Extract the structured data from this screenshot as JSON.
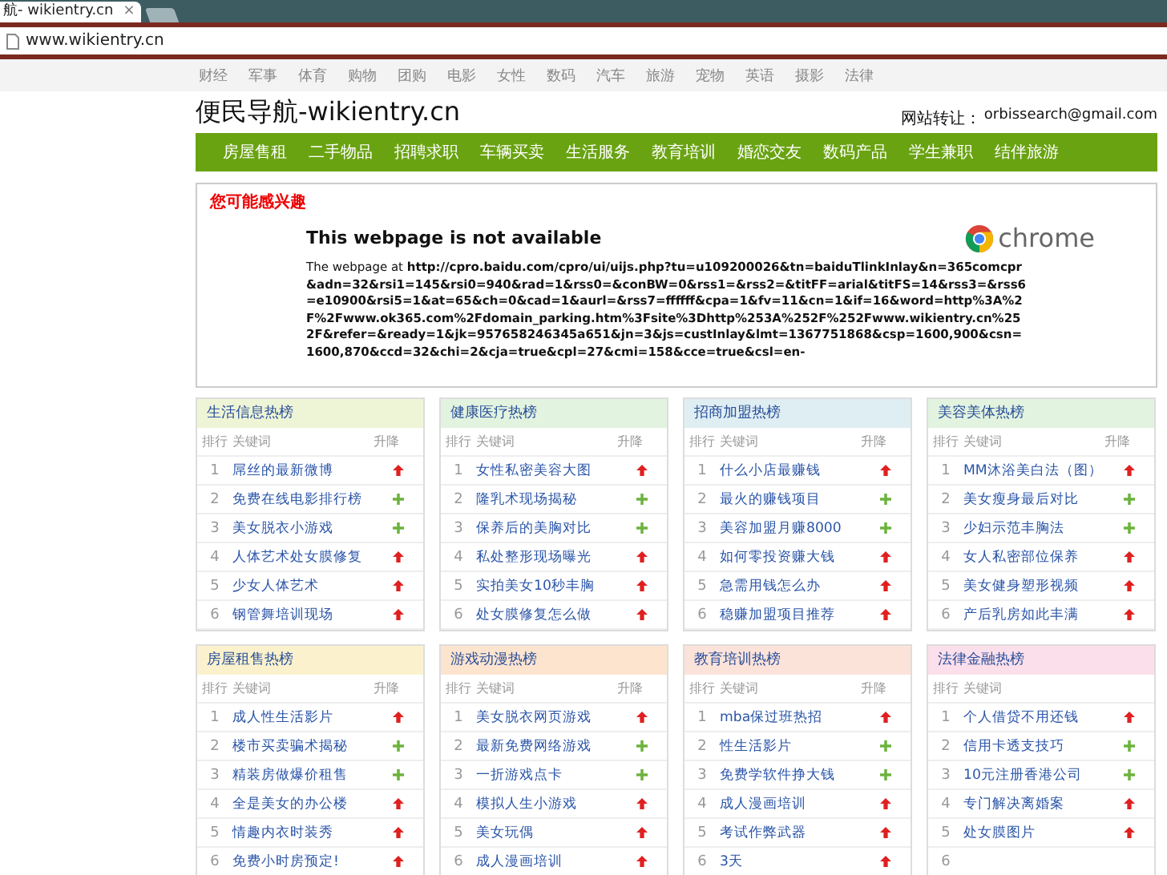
{
  "browser": {
    "tab_title": "航- wikientry.cn",
    "tab_close": "×",
    "address": "www.wikientry.cn"
  },
  "categories": [
    "财经",
    "军事",
    "体育",
    "购物",
    "团购",
    "电影",
    "女性",
    "数码",
    "汽车",
    "旅游",
    "宠物",
    "英语",
    "摄影",
    "法律"
  ],
  "site": {
    "title": "便民导航-wikientry.cn",
    "contact_label": "网站转让：",
    "contact_email": "orbissearch@gmail.com"
  },
  "nav": [
    "房屋售租",
    "二手物品",
    "招聘求职",
    "车辆买卖",
    "生活服务",
    "教育培训",
    "婚恋交友",
    "数码产品",
    "学生兼职",
    "结伴旅游"
  ],
  "notice": {
    "heading": "您可能感兴趣",
    "error_title": "This webpage is not available",
    "brand": "chrome",
    "message_prefix": "The webpage at ",
    "message_url": "http://cpro.baidu.com/cpro/ui/uijs.php?tu=u109200026&tn=baiduTlinkInlay&n=365comcpr&adn=32&rsi1=145&rsi0=940&rad=1&rss0=&conBW=0&rss1=&rss2=&titFF=arial&titFS=14&rss3=&rss6=e10900&rsi5=1&at=65&ch=0&cad=1&aurl=&rss7=ffffff&cpa=1&fv=11&cn=1&if=16&word=http%3A%2F%2Fwww.ok365.com%2Fdomain_parking.htm%3Fsite%3Dhttp%253A%252F%252Fwww.wikientry.cn%252F&refer=&ready=1&jk=957658246345a651&jn=3&js=custInlay&lmt=1367751868&csp=1600,900&csn=1600,870&ccd=32&chi=2&cja=true&cpl=27&cmi=158&cce=true&csl=en-"
  },
  "boards": [
    {
      "title": "生活信息热榜",
      "color": "#eef5d6",
      "columns": [
        "排行",
        "关键词",
        "升降"
      ],
      "rows": [
        {
          "rank": "1",
          "keyword": "屌丝的最新微博",
          "rising": true
        },
        {
          "rank": "2",
          "keyword": "免费在线电影排行榜",
          "rising": false
        },
        {
          "rank": "3",
          "keyword": "美女脱衣小游戏",
          "rising": false
        },
        {
          "rank": "4",
          "keyword": "人体艺术处女膜修复",
          "rising": true
        },
        {
          "rank": "5",
          "keyword": "少女人体艺术",
          "rising": true
        },
        {
          "rank": "6",
          "keyword": "钢管舞培训现场",
          "rising": true
        }
      ]
    },
    {
      "title": "健康医疗热榜",
      "color": "#e2f3df",
      "columns": [
        "排行",
        "关键词",
        "升降"
      ],
      "rows": [
        {
          "rank": "1",
          "keyword": "女性私密美容大图",
          "rising": true
        },
        {
          "rank": "2",
          "keyword": "隆乳术现场揭秘",
          "rising": false
        },
        {
          "rank": "3",
          "keyword": "保养后的美胸对比",
          "rising": false
        },
        {
          "rank": "4",
          "keyword": "私处整形现场曝光",
          "rising": true
        },
        {
          "rank": "5",
          "keyword": "实拍美女10秒丰胸",
          "rising": true
        },
        {
          "rank": "6",
          "keyword": "处女膜修复怎么做",
          "rising": true
        }
      ]
    },
    {
      "title": "招商加盟热榜",
      "color": "#dfeef3",
      "columns": [
        "排行",
        "关键词",
        "升降"
      ],
      "rows": [
        {
          "rank": "1",
          "keyword": "什么小店最赚钱",
          "rising": true
        },
        {
          "rank": "2",
          "keyword": "最火的赚钱项目",
          "rising": false
        },
        {
          "rank": "3",
          "keyword": "美容加盟月赚8000",
          "rising": false
        },
        {
          "rank": "4",
          "keyword": "如何零投资赚大钱",
          "rising": true
        },
        {
          "rank": "5",
          "keyword": "急需用钱怎么办",
          "rising": true
        },
        {
          "rank": "6",
          "keyword": "稳赚加盟项目推荐",
          "rising": true
        }
      ]
    },
    {
      "title": "美容美体热榜",
      "color": "#e2f3df",
      "columns": [
        "排行",
        "关键词",
        "升降"
      ],
      "rows": [
        {
          "rank": "1",
          "keyword": "MM沐浴美白法（图）",
          "rising": true
        },
        {
          "rank": "2",
          "keyword": "美女瘦身最后对比",
          "rising": false
        },
        {
          "rank": "3",
          "keyword": "少妇示范丰胸法",
          "rising": false
        },
        {
          "rank": "4",
          "keyword": "女人私密部位保养",
          "rising": true
        },
        {
          "rank": "5",
          "keyword": "美女健身塑形视频",
          "rising": true
        },
        {
          "rank": "6",
          "keyword": "产后乳房如此丰满",
          "rising": true
        }
      ]
    },
    {
      "title": "房屋租售热榜",
      "color": "#fbf2cd",
      "columns": [
        "排行",
        "关键词",
        "升降"
      ],
      "rows": [
        {
          "rank": "1",
          "keyword": "成人性生活影片",
          "rising": true
        },
        {
          "rank": "2",
          "keyword": "楼市买卖骗术揭秘",
          "rising": false
        },
        {
          "rank": "3",
          "keyword": "精装房做爆价租售",
          "rising": false
        },
        {
          "rank": "4",
          "keyword": "全是美女的办公楼",
          "rising": true
        },
        {
          "rank": "5",
          "keyword": "情趣内衣时装秀",
          "rising": true
        },
        {
          "rank": "6",
          "keyword": "免费小时房预定!",
          "rising": true
        }
      ]
    },
    {
      "title": "游戏动漫热榜",
      "color": "#fde4cf",
      "columns": [
        "排行",
        "关键词",
        "升降"
      ],
      "rows": [
        {
          "rank": "1",
          "keyword": "美女脱衣网页游戏",
          "rising": true
        },
        {
          "rank": "2",
          "keyword": "最新免费网络游戏",
          "rising": false
        },
        {
          "rank": "3",
          "keyword": "一折游戏点卡",
          "rising": false
        },
        {
          "rank": "4",
          "keyword": "模拟人生小游戏",
          "rising": true
        },
        {
          "rank": "5",
          "keyword": "美女玩偶",
          "rising": true
        },
        {
          "rank": "6",
          "keyword": "成人漫画培训",
          "rising": true
        }
      ]
    },
    {
      "title": "教育培训热榜",
      "color": "#fce3da",
      "columns": [
        "排行",
        "关键词",
        "升降"
      ],
      "rows": [
        {
          "rank": "1",
          "keyword": "mba保过班热招",
          "rising": true
        },
        {
          "rank": "2",
          "keyword": "性生活影片",
          "rising": false
        },
        {
          "rank": "3",
          "keyword": "免费学软件挣大钱",
          "rising": false
        },
        {
          "rank": "4",
          "keyword": "成人漫画培训",
          "rising": true
        },
        {
          "rank": "5",
          "keyword": "考试作弊武器",
          "rising": true
        },
        {
          "rank": "6",
          "keyword": "3天",
          "rising": true
        }
      ]
    },
    {
      "title": "法律金融热榜",
      "color": "#fbdfeb",
      "columns": [
        "排行",
        "关键词"
      ],
      "rows": [
        {
          "rank": "1",
          "keyword": "个人借贷不用还钱",
          "rising": true
        },
        {
          "rank": "2",
          "keyword": "信用卡透支技巧",
          "rising": false
        },
        {
          "rank": "3",
          "keyword": "10元注册香港公司",
          "rising": false
        },
        {
          "rank": "4",
          "keyword": "专门解决离婚案",
          "rising": true
        },
        {
          "rank": "5",
          "keyword": "处女膜图片",
          "rising": true
        },
        {
          "rank": "6"
        }
      ]
    }
  ]
}
